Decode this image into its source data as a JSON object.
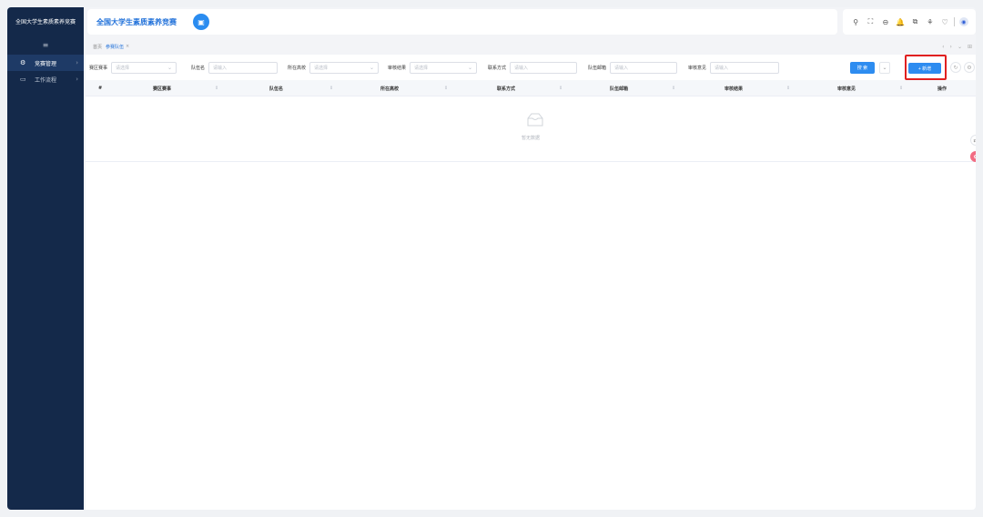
{
  "sidebar": {
    "title": "全国大学生素质素养竞赛",
    "toggle_icon": "≡",
    "items": [
      {
        "icon": "⚙",
        "label": "竞赛管理",
        "active": true
      },
      {
        "icon": "▭",
        "label": "工作流程",
        "active": false
      }
    ]
  },
  "header": {
    "title": "全国大学生素质素养竞赛",
    "badge_icon": "▣",
    "tools": [
      "⚲",
      "⛶",
      "⊖",
      "🔔",
      "⧉",
      "⚘",
      "♡"
    ]
  },
  "tabs": {
    "home": "首页",
    "active": "参赛队伍",
    "close": "×"
  },
  "search": {
    "fields": [
      {
        "label": "赛区赛事",
        "placeholder": "请选择",
        "select": true
      },
      {
        "label": "队伍名",
        "placeholder": "请输入",
        "select": false
      },
      {
        "label": "所在高校",
        "placeholder": "请选择",
        "select": true
      },
      {
        "label": "审核结果",
        "placeholder": "请选择",
        "select": true
      },
      {
        "label": "联系方式",
        "placeholder": "请输入",
        "select": false
      },
      {
        "label": "队伍邮箱",
        "placeholder": "请输入",
        "select": false
      },
      {
        "label": "审核意见",
        "placeholder": "请输入",
        "select": false
      }
    ],
    "search_button": "搜 索",
    "add_button": "+ 新增"
  },
  "table": {
    "columns": [
      "#",
      "赛区赛事",
      "队伍名",
      "所在高校",
      "联系方式",
      "队伍邮箱",
      "审核结果",
      "审核意见",
      "操作"
    ],
    "empty_text": "暂无数据"
  },
  "colors": {
    "sidebar": "#14294a",
    "primary": "#2d8cf0",
    "highlight": "#e02020"
  }
}
